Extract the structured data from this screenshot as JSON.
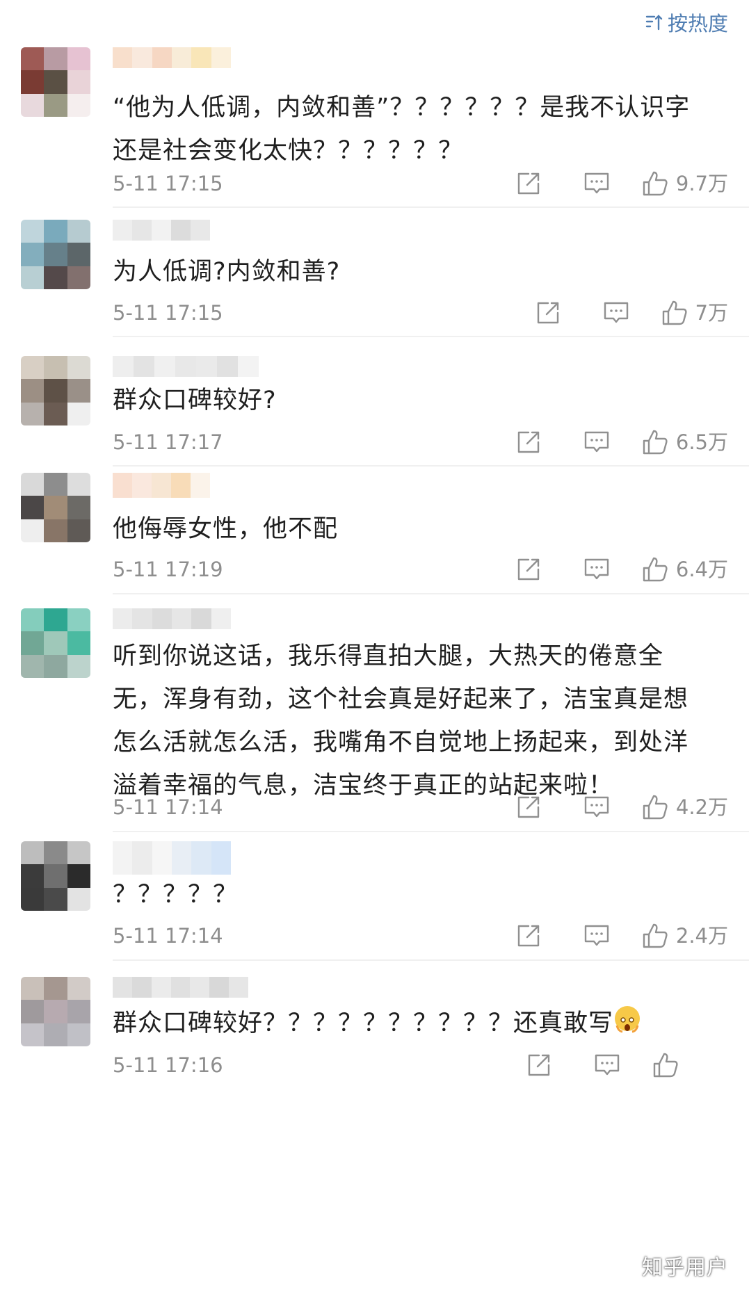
{
  "sort": {
    "label": "按热度",
    "icon": "sort-icon"
  },
  "comments": [
    {
      "text_lines": [
        "“他为人低调，内敛和善”？？？？？？是我不认识字",
        "还是社会变化太快？？？？？？"
      ],
      "time": "5-11 17:15",
      "likes": "9.7万",
      "avatar_colors": [
        "#9e5a55",
        "#b89ba3",
        "#e6c2d2",
        "#7a3b33",
        "#5a5044",
        "#e9d3d8",
        "#e8d9dd",
        "#9a9a84",
        "#f5eeee"
      ],
      "name_colors": [
        "#f8dfcc",
        "#f9e9dd",
        "#f6d7c3",
        "#f8ecd8",
        "#f9e6b8",
        "#fbf0dc"
      ]
    },
    {
      "text_lines": [
        "为人低调?内敛和善?"
      ],
      "time": "5-11 17:15",
      "likes": "7万",
      "avatar_colors": [
        "#bfd5dc",
        "#7aaabc",
        "#b6cbd0",
        "#83aebd",
        "#66808a",
        "#5c6669",
        "#b8cfd3",
        "#54494a",
        "#82706e"
      ],
      "name_colors": [
        "#eeeeee",
        "#e6e6e6",
        "#f2f2f2",
        "#dcdcdc",
        "#e8e8e8"
      ]
    },
    {
      "text_lines": [
        "群众口碑较好?"
      ],
      "time": "5-11 17:17",
      "likes": "6.5万",
      "avatar_colors": [
        "#d8cfc4",
        "#c7bfb1",
        "#dcdad3",
        "#9c8f84",
        "#5e5147",
        "#9a9088",
        "#b7b1ad",
        "#6b5c53",
        "#efefef"
      ],
      "name_colors": [
        "#eeeeee",
        "#e3e3e3",
        "#f0f0f0",
        "#e8e8e8",
        "#eaeaea",
        "#e1e1e1",
        "#f3f3f3"
      ]
    },
    {
      "text_lines": [
        "他侮辱女性，他不配"
      ],
      "time": "5-11 17:19",
      "likes": "6.4万",
      "avatar_colors": [
        "#d9d9d9",
        "#8d8d8d",
        "#dddddd",
        "#4b4747",
        "#a18c77",
        "#6c6a66",
        "#eeeeee",
        "#887567",
        "#5f5a56"
      ],
      "name_colors": [
        "#f9dfd0",
        "#fae8de",
        "#f7e6d3",
        "#f8dcb8",
        "#fbf3ea"
      ]
    },
    {
      "text_lines": [
        "听到你说这话，我乐得直拍大腿，大热天的倦意全",
        "无，浑身有劲，这个社会真是好起来了，洁宝真是想",
        "怎么活就怎么活，我嘴角不自觉地上扬起来，到处洋",
        "溢着幸福的气息，洁宝终于真正的站起来啦！"
      ],
      "time": "5-11 17:14",
      "likes": "4.2万",
      "avatar_colors": [
        "#84cdbc",
        "#2ea791",
        "#8ad0c1",
        "#71a795",
        "#9fc8b9",
        "#4bbaa1",
        "#a0b6ad",
        "#8ea89f",
        "#bcd3cc"
      ],
      "name_colors": [
        "#ececec",
        "#e4e4e4",
        "#dcdcdc",
        "#e6e6e6",
        "#d9d9d9",
        "#efefef"
      ]
    },
    {
      "text_lines": [
        "？？？？？"
      ],
      "time": "5-11 17:14",
      "likes": "2.4万",
      "avatar_colors": [
        "#bdbdbd",
        "#8a8a8a",
        "#c6c6c6",
        "#3b3b3b",
        "#6f6f6f",
        "#2b2b2b",
        "#3a3a3a",
        "#4a4a4a",
        "#e3e3e3"
      ],
      "name_colors": [
        "#f3f3f3",
        "#ececec",
        "#f6f6f6",
        "#e8eef5",
        "#dde9f6",
        "#d5e5f8"
      ]
    },
    {
      "text_lines": [
        "群众口碑较好？？？？？？？？？？还真敢写"
      ],
      "time": "5-11 17:16",
      "likes": "",
      "avatar_colors": [
        "#c9c0b9",
        "#a59790",
        "#d2cbc7",
        "#9f9a9d",
        "#b7aab0",
        "#a8a4aa",
        "#c5c3c9",
        "#aeadb3",
        "#c0c0c6"
      ],
      "name_colors": [
        "#e3e3e3",
        "#dadada",
        "#ebebeb",
        "#e0e0e0",
        "#e8e8e8",
        "#d8d8d8",
        "#e6e6e6"
      ]
    }
  ],
  "watermark": "知乎用户"
}
